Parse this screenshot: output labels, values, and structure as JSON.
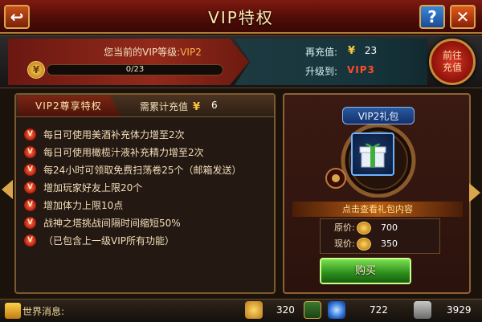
{
  "header": {
    "title": "VIP特权",
    "back_icon": "↩",
    "help_label": "?",
    "close_label": "✕"
  },
  "status": {
    "current_level_prefix": "您当前的VIP等级:",
    "current_level": "VIP2",
    "progress_text": "0/23",
    "progress_fraction": 0,
    "recharge_label": "再充值:",
    "recharge_value": "23",
    "upgrade_label": "升级到:",
    "upgrade_value": "VIP3",
    "goto_recharge_line1": "前往",
    "goto_recharge_line2": "充值",
    "currency_symbol": "¥"
  },
  "privileges": {
    "tab_label": "VIP2尊享特权",
    "required_label": "需累计充值",
    "required_value": "6",
    "bullet_mark": "V",
    "items": [
      "每日可使用美酒补充体力增至2次",
      "每日可使用橄榄汁液补充精力增至2次",
      "每24小时可领取免费扫荡卷25个（邮箱发送）",
      "增加玩家好友上限20个",
      "增加体力上限10点",
      "战神之塔挑战间隔时间缩短50%",
      "（已包含上一级VIP所有功能）"
    ]
  },
  "gift": {
    "title": "VIP2礼包",
    "view_contents": "点击查看礼包内容",
    "original_price_label": "原价:",
    "original_price": "700",
    "current_price_label": "现价:",
    "current_price": "350",
    "buy_label": "购买"
  },
  "bottom": {
    "world_message_label": "世界消息:",
    "gold": "320",
    "crystals": "722",
    "power": "3929"
  },
  "colors": {
    "accent_gold": "#d9a64b",
    "level_highlight": "#ff4a2a",
    "buy_green": "#2b8d1b"
  }
}
